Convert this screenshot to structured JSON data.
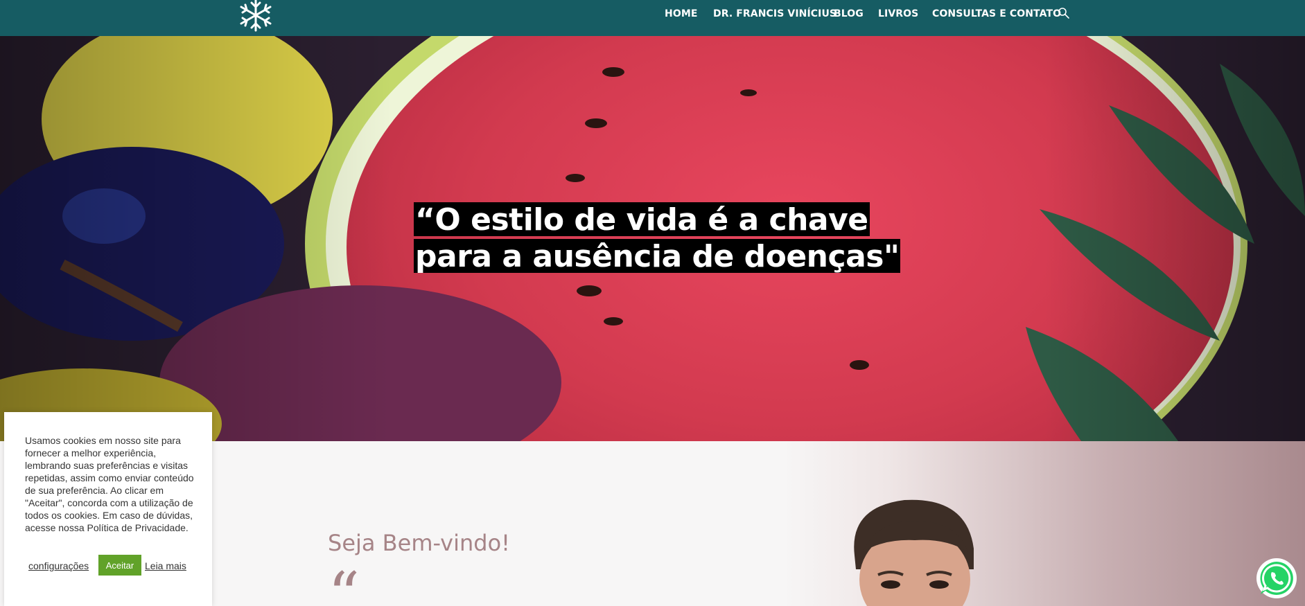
{
  "header": {
    "nav": [
      {
        "label": "HOME"
      },
      {
        "label": "DR. FRANCIS VINÍCIUS"
      },
      {
        "label": "BLOG"
      },
      {
        "label": "LIVROS"
      },
      {
        "label": "CONSULTAS E CONTATO"
      }
    ],
    "search_icon": "search-icon",
    "logo_icon": "snowflake-logo-icon"
  },
  "hero": {
    "quote_line1": "“O estilo de vida é a chave",
    "quote_line2": "para a ausência de doenças\""
  },
  "welcome": {
    "title": "Seja Bem-vindo!",
    "quote_mark": "“"
  },
  "cookie": {
    "text": "Usamos cookies em nosso site para fornecer a melhor experiência, lembrando suas preferências e visitas repetidas, assim como enviar conteúdo de sua preferência. Ao clicar em \"Aceitar\", concorda com a utilização de todos os cookies. Em caso de dúvidas, acesse nossa Política de Privacidade.",
    "settings_label": "configurações",
    "accept_label": "Aceitar",
    "more_label": "Leia mais"
  },
  "colors": {
    "header_bg": "#165c63",
    "accent_rose": "#a68487",
    "accept_green": "#61a229",
    "whatsapp_green": "#25d366"
  }
}
